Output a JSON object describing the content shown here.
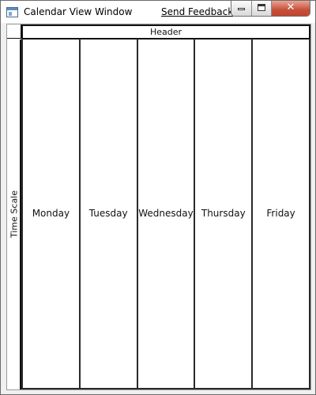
{
  "window": {
    "title": "Calendar View Window",
    "feedback_link": "Send Feedback",
    "close_glyph": "✕"
  },
  "calendar": {
    "header_label": "Header",
    "time_scale_label": "Time Scale",
    "days": [
      "Monday",
      "Tuesday",
      "Wednesday",
      "Thursday",
      "Friday"
    ]
  },
  "colors": {
    "close_button": "#c7503a",
    "app_icon_accent": "#5b8fbe",
    "grid_lines": "#2a2a2a"
  }
}
